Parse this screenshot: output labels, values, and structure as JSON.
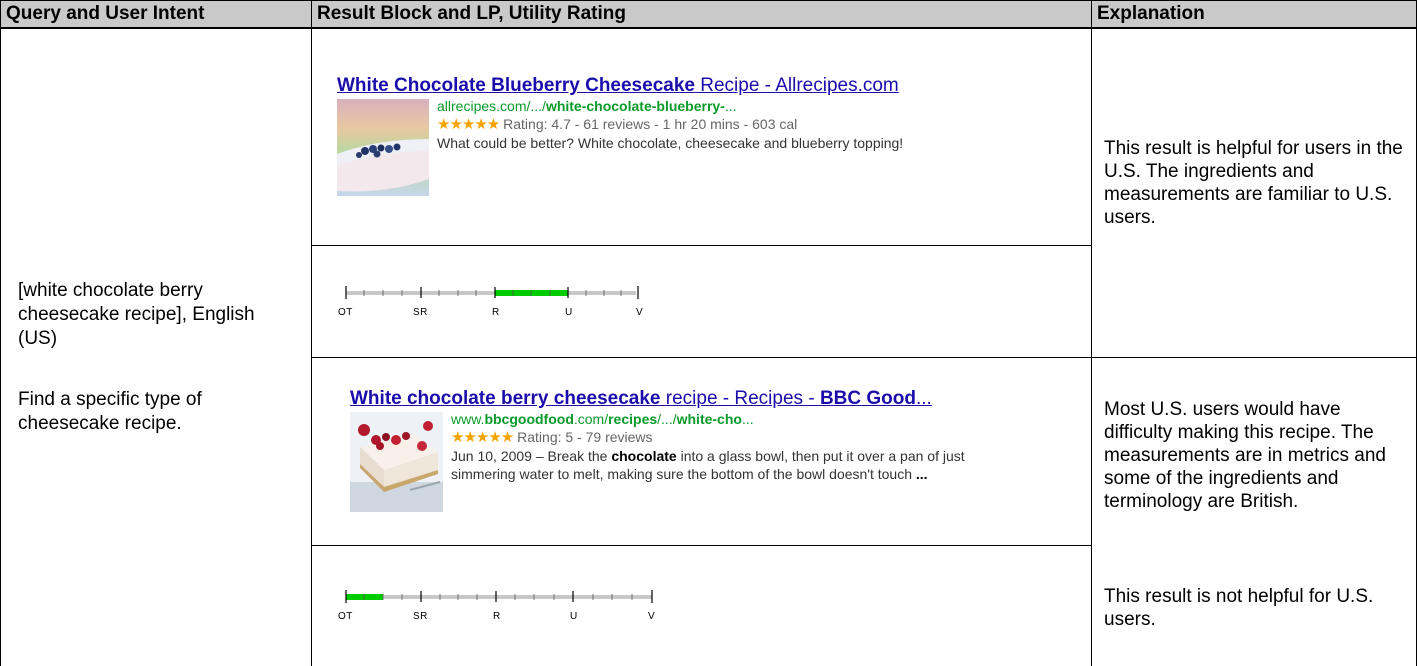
{
  "header": {
    "col1": "Query and User Intent",
    "col2": "Result Block and LP, Utility Rating",
    "col3": "Explanation"
  },
  "intent": {
    "query": "[white chocolate berry cheesecake recipe], English (US)",
    "goal": "Find a specific type of cheesecake recipe."
  },
  "results": [
    {
      "title_bold": "White Chocolate Blueberry Cheesecake",
      "title_rest": " Recipe - Allrecipes.com",
      "url_pre": "allrecipes.com/.../",
      "url_bold": "white-chocolate-blueberry-",
      "url_post": "...",
      "stars": "★★★★★",
      "meta": "Rating: 4.7 - 61 reviews - 1 hr 20 mins - 603 cal",
      "snippet": "What could be better? White chocolate, cheesecake and blueberry topping!",
      "rating": "U-",
      "explanation": "This result is helpful for users in the U.S.  The ingredients and measurements are familiar to U.S. users."
    },
    {
      "title_bold1": "White chocolate berry cheesecake",
      "title_mid": " recipe - Recipes - ",
      "title_bold2": "BBC Good",
      "title_post": "...",
      "url_pre": "www.",
      "url_bold1": "bbcgoodfood",
      "url_mid": ".com/",
      "url_bold2": "recipes",
      "url_mid2": "/.../",
      "url_bold3": "white-cho",
      "url_post": "...",
      "stars": "★★★★★",
      "meta": "Rating: 5 - 79 reviews",
      "snippet_pre": "Jun 10, 2009 – Break the ",
      "snippet_bold": "chocolate",
      "snippet_post": " into a glass bowl, then put it over a pan of just simmering water to melt, making sure the bottom of the bowl doesn't touch ",
      "snippet_ellipsis": "...",
      "rating": "OT+",
      "explanation1": "Most U.S. users would have difficulty making this recipe.  The measurements are in metrics and some of the ingredients and terminology are British.",
      "explanation2": "This result is not helpful for U.S. users."
    }
  ],
  "scale": {
    "labels": [
      "OT",
      "SR",
      "R",
      "U",
      "V"
    ],
    "rating_fill": [
      {
        "from": 2.0,
        "to": 3.0,
        "color": "#00cc00"
      },
      {
        "from": 0.0,
        "to": 0.5,
        "color": "#00cc00"
      }
    ]
  },
  "colors": {
    "header_bg": "#c9c9c9",
    "link": "#1a0dab",
    "url": "#0a9a2a",
    "stars": "#f4a300",
    "scale_track": "#c8c8c8",
    "scale_fill": "#00cc00"
  }
}
